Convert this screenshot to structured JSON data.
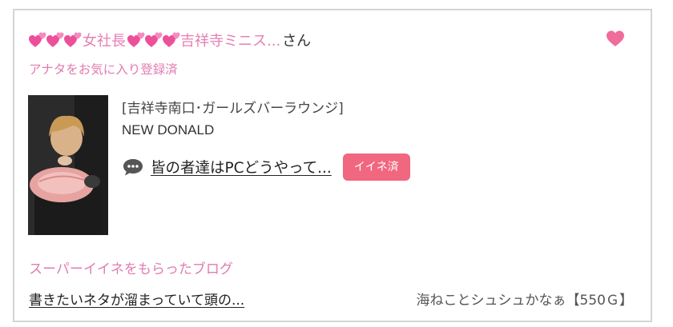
{
  "card": {
    "title_name": "女社長",
    "title_name2": "吉祥寺ミニス...",
    "title_suffix": "さん",
    "favorite_status": "アナタをお気に入り登録済",
    "venue": "[吉祥寺南口･ガールズバーラウンジ]",
    "shop_name": "NEW DONALD",
    "post_title": "皆の者達はPCどうやって...",
    "iine_label": "イイネ済",
    "section_title": "スーパーイイネをもらったブログ",
    "blog_title": "書きたいネタが溜まっていて頭の...",
    "gift_text": "海ねことシュシュかなぁ【550Ｇ】"
  },
  "colors": {
    "pink_text": "#e27bb0",
    "heart_pink": "#f06c9b",
    "badge": "#f0677f"
  },
  "icons": [
    "two-hearts-icon",
    "heart-icon",
    "speech-bubble-icon"
  ]
}
